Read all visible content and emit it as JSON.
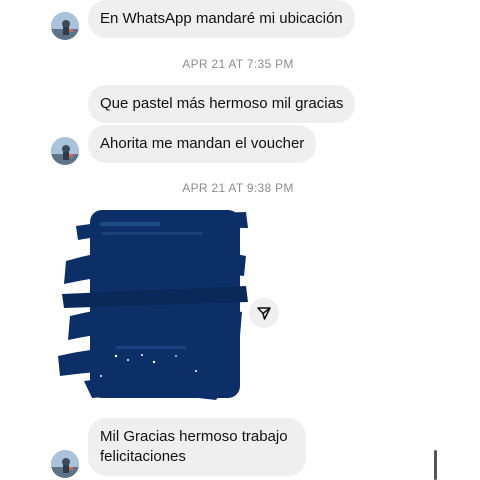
{
  "conversation": {
    "messages": [
      {
        "text": "En WhatsApp mandaré mi ubicación"
      },
      {
        "text": "Que pastel más hermoso mil gracias"
      },
      {
        "text": "Ahorita me mandan el voucher"
      },
      {
        "text": "Mil Gracias hermoso trabajo felicitaciones"
      }
    ],
    "timestamps": [
      "APR 21 AT 7:35 PM",
      "APR 21 AT 9:38 PM"
    ],
    "photo": {
      "description": "scribbled-out-image"
    }
  },
  "icons": {
    "avatar": "profile-avatar",
    "share": "send-arrow-icon"
  },
  "colors": {
    "bubble_bg": "#efefef",
    "redaction": "#0d2f68",
    "timestamp_text": "#8e8e8e",
    "message_text": "#111111"
  }
}
